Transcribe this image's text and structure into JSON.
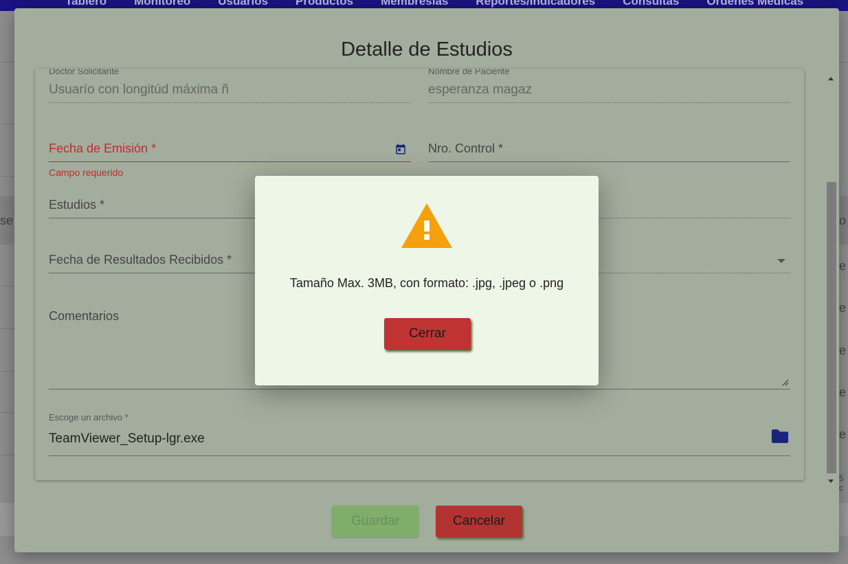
{
  "background": {
    "nav_items": [
      "Tablero",
      "Monitoreo",
      "Usuarios",
      "Productos",
      "Membresías",
      "Reportes/Indicadores",
      "Consultas",
      "Órdenes Médicas"
    ],
    "left_partial_text": "se",
    "right_partial_text": [
      "o",
      "e",
      "e",
      "e",
      "e",
      "e",
      "5 c"
    ]
  },
  "dialog": {
    "title": "Detalle de Estudios",
    "fields": {
      "doctor": {
        "label": "Doctor Solicitante",
        "value": "Usuarío con longitúd máxima ñ"
      },
      "patient": {
        "label": "Nombre de Paciente",
        "value": "esperanza magaz"
      },
      "emission_date": {
        "label": "Fecha de Emisión *",
        "error": "Campo requerido",
        "icon": "calendar-icon"
      },
      "control_number": {
        "label": "Nro. Control *"
      },
      "studies": {
        "label": "Estudios *"
      },
      "results_date": {
        "label": "Fecha de Resultados Recibidos *"
      },
      "comments": {
        "label": "Comentarios"
      },
      "file": {
        "label": "Escoge un archivo *",
        "value": "TeamViewer_Setup-lgr.exe",
        "icon": "folder-icon"
      }
    },
    "buttons": {
      "save": "Guardar",
      "cancel": "Cancelar"
    }
  },
  "alert": {
    "icon": "warning-icon",
    "message": "Tamaño Max. 3MB, con formato: .jpg, .jpeg o .png",
    "close_label": "Cerrar"
  },
  "colors": {
    "nav": "#1a1380",
    "error": "#c62828",
    "warning": "#f5a00c",
    "save_button": "#7fae6a",
    "cancel_button": "#b33232",
    "icon_blue": "#1a237e"
  }
}
